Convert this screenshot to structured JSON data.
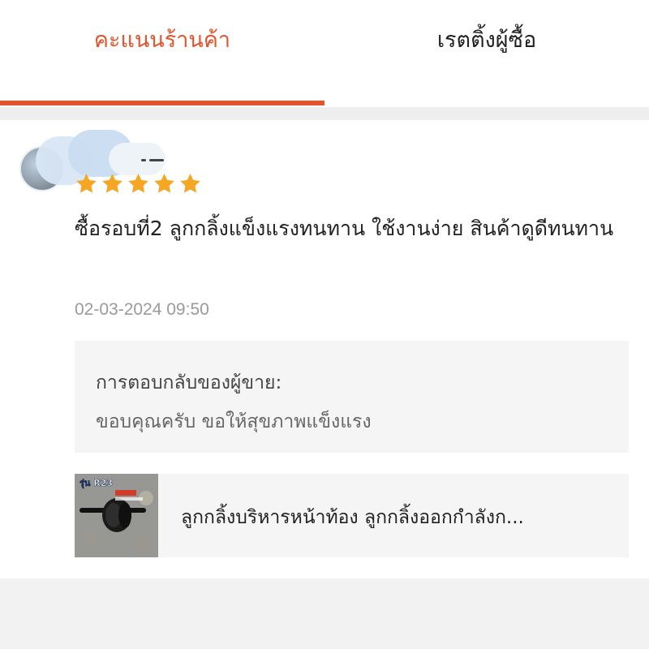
{
  "colors": {
    "accent": "#e0552d",
    "star": "#f5a623"
  },
  "tabs": [
    {
      "label": "คะแนนร้านค้า",
      "active": true
    },
    {
      "label": "เรตติ้งผู้ซื้อ",
      "active": false
    }
  ],
  "review": {
    "rating": 5,
    "max_rating": 5,
    "text": "ซื้อรอบที่2 ลูกกลิ้งแข็งแรงทนทาน ใช้งานง่าย สินค้าดูดีทนทาน",
    "date": "02-03-2024 09:50"
  },
  "seller_reply": {
    "title": "การตอบกลับของผู้ขาย:",
    "text": "ขอบคุณครับ ขอให้สุขภาพแข็งแรง"
  },
  "product": {
    "name": "ลูกกลิ้งบริหารหน้าท้อง ลูกกลิ้งออกกำลังก...",
    "thumb_label": "รุ่น R23",
    "thumb_icon": "ab-roller-wheel"
  }
}
